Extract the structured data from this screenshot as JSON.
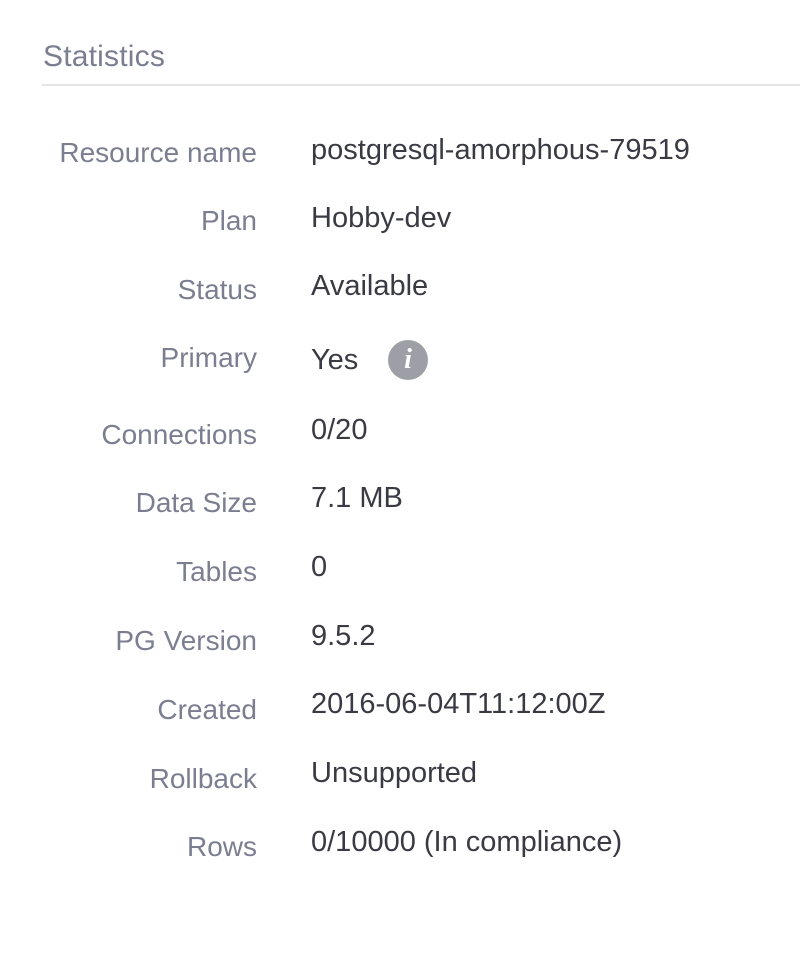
{
  "section": {
    "title": "Statistics"
  },
  "stats": [
    {
      "label": "Resource name",
      "value": "postgresql-amorphous-79519"
    },
    {
      "label": "Plan",
      "value": "Hobby-dev"
    },
    {
      "label": "Status",
      "value": "Available"
    },
    {
      "label": "Primary",
      "value": "Yes",
      "icon": "info-icon"
    },
    {
      "label": "Connections",
      "value": "0/20"
    },
    {
      "label": "Data Size",
      "value": "7.1 MB"
    },
    {
      "label": "Tables",
      "value": "0"
    },
    {
      "label": "PG Version",
      "value": "9.5.2"
    },
    {
      "label": "Created",
      "value": "2016-06-04T11:12:00Z"
    },
    {
      "label": "Rollback",
      "value": "Unsupported"
    },
    {
      "label": "Rows",
      "value": "0/10000 (In compliance)"
    }
  ]
}
